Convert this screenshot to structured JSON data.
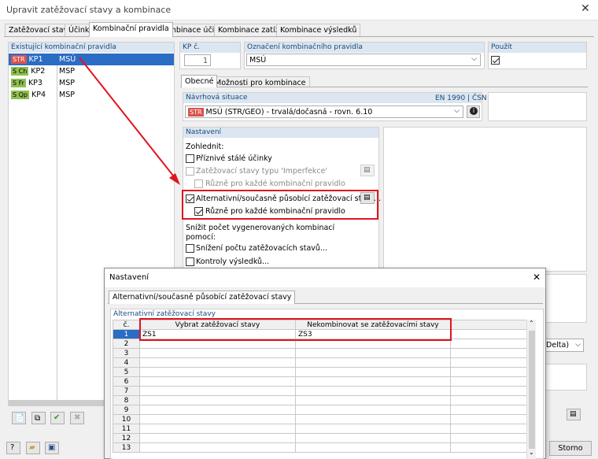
{
  "window": {
    "title": "Upravit zatěžovací stavy a kombinace"
  },
  "tabs": [
    "Zatěžovací stavy",
    "Účinky",
    "Kombinační pravidla",
    "Kombinace účinků",
    "Kombinace zatížení",
    "Kombinace výsledků"
  ],
  "rules_list": {
    "header": "Existující kombinační pravidla",
    "items": [
      {
        "badge": "STR",
        "badge_color": "#d9534f",
        "id": "KP1",
        "name": "MSÚ"
      },
      {
        "badge": "S Ch",
        "badge_color": "#8fbf4f",
        "id": "KP2",
        "name": "MSP"
      },
      {
        "badge": "S Fr",
        "badge_color": "#8fbf4f",
        "id": "KP3",
        "name": "MSP"
      },
      {
        "badge": "S Qp",
        "badge_color": "#8fbf4f",
        "id": "KP4",
        "name": "MSP"
      }
    ]
  },
  "kp": {
    "label": "KP č.",
    "value": "1"
  },
  "designation": {
    "label": "Označení kombinačního pravidla",
    "value": "MSÚ"
  },
  "use": {
    "label": "Použít"
  },
  "subtabs": [
    "Obecné",
    "Možnosti pro kombinace"
  ],
  "design_situation": {
    "label": "Návrhová situace",
    "norm": "EN 1990 | ČSN",
    "badge": "STR",
    "value": "MSÚ (STR/GEO) - trvalá/dočasná - rovn. 6.10"
  },
  "settings": {
    "header": "Nastavení",
    "consider": "Zohlednit:",
    "favorable": "Příznivé stálé účinky",
    "imperfection": "Zatěžovací stavy typu 'Imperfekce'",
    "diff1": "Různě pro každé kombinační pravidlo",
    "alternative": "Alternativní/současně působící zatěžovací stavy...",
    "diff2": "Různě pro každé kombinační pravidlo",
    "reduce_title": "Snížit počet vygenerovaných kombinací pomocí:",
    "reduce_ls": "Snížení počtu zatěžovacích stavů...",
    "checks": "Kontroly výsledků..."
  },
  "right_dropdown_fragment": "Delta)",
  "footer": {
    "cancel": "Storno"
  },
  "dialog": {
    "title": "Nastavení",
    "tab": "Alternativní/současně působící zatěžovací stavy",
    "group": "Alternativní zatěžovací stavy",
    "col_no": "č.",
    "col_select": "Vybrat zatěžovací stavy",
    "col_nocombine": "Nekombinovat se zatěžovacími stavy",
    "rows": [
      {
        "n": "1",
        "a": "ZS1",
        "b": "ZS3"
      },
      {
        "n": "2",
        "a": "",
        "b": ""
      },
      {
        "n": "3",
        "a": "",
        "b": ""
      },
      {
        "n": "4",
        "a": "",
        "b": ""
      },
      {
        "n": "5",
        "a": "",
        "b": ""
      },
      {
        "n": "6",
        "a": "",
        "b": ""
      },
      {
        "n": "7",
        "a": "",
        "b": ""
      },
      {
        "n": "8",
        "a": "",
        "b": ""
      },
      {
        "n": "9",
        "a": "",
        "b": ""
      },
      {
        "n": "10",
        "a": "",
        "b": ""
      },
      {
        "n": "11",
        "a": "",
        "b": ""
      },
      {
        "n": "12",
        "a": "",
        "b": ""
      },
      {
        "n": "13",
        "a": "",
        "b": ""
      }
    ]
  },
  "colors": {
    "accent": "#2b6cc4",
    "highlight": "#e0141e",
    "header_bg": "#dbe6f1"
  }
}
